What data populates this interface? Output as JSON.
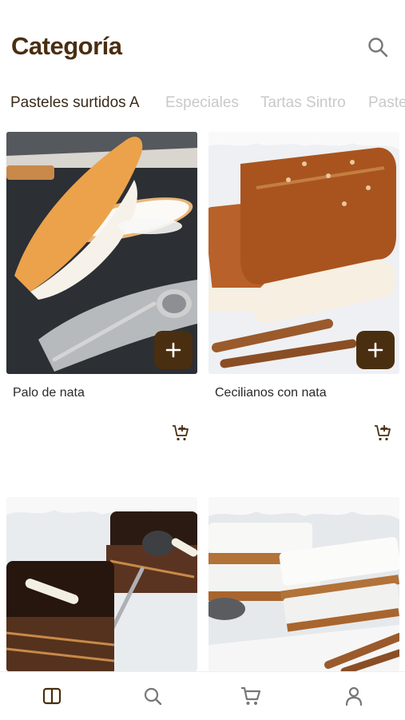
{
  "header": {
    "title": "Categoría"
  },
  "tabs": [
    {
      "label": "Pasteles surtidos A"
    },
    {
      "label": "Especiales"
    },
    {
      "label": "Tartas Sintro"
    },
    {
      "label": "Paste"
    }
  ],
  "products": [
    {
      "name": "Palo de nata"
    },
    {
      "name": "Cecilianos con nata"
    },
    {
      "name": ""
    },
    {
      "name": ""
    }
  ],
  "colors": {
    "brand": "#4a2e10",
    "tab_inactive": "#c9c9c9"
  },
  "icons": {
    "search": "search-icon",
    "add": "plus-icon",
    "cart_add": "cart-plus-icon",
    "nav": [
      "catalog-icon",
      "search-icon",
      "cart-icon",
      "user-icon"
    ]
  }
}
